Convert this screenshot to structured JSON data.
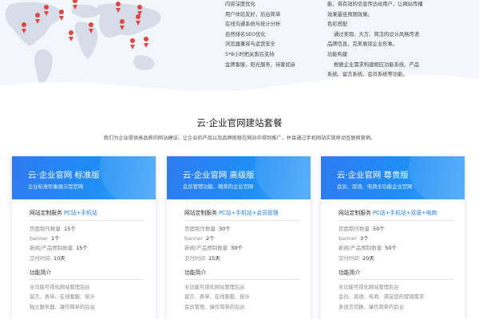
{
  "features_mid": [
    {
      "text": "内容深度优化",
      "indent": false
    },
    {
      "text": "用户体验友好，后台简单",
      "indent": false
    },
    {
      "text": "在线沟通系统与统计分析",
      "indent": false
    },
    {
      "text": "自然排名SEO优化",
      "indent": false
    },
    {
      "text": "浏览器兼容与运营安全",
      "indent": false
    },
    {
      "text": "5*8小时把关售后支持",
      "indent": false
    },
    {
      "text": "金牌客服，阳光服务，待客如亲",
      "indent": false
    }
  ],
  "features_right": [
    {
      "text": "能，将有效的信息传达给用户，让网站传播",
      "indent": false
    },
    {
      "text": "效果最佳预期效果。",
      "indent": false
    },
    {
      "text": "色彩搭配",
      "indent": false
    },
    {
      "text": "通过美观、大方、简洁的设计风格传递",
      "indent": true
    },
    {
      "text": "品牌信息，完美展现企业形象。",
      "indent": false
    },
    {
      "text": "功能构建",
      "indent": false
    },
    {
      "text": "根据企业需求构建相应功能系统、产品",
      "indent": true
    },
    {
      "text": "系统、留言系统、会员系统等功能。",
      "indent": false
    }
  ],
  "section": {
    "title": "云·企业官网建站套餐",
    "description": "我们为企业提供高品质的网站建设，让企业的产品以及品牌能够在网站中得到推广，并且通过手机网站实现移动互联网营销。"
  },
  "cards": [
    {
      "title": "云·企业官网 标准版",
      "subtitle": "企业标准形象展示型官网",
      "service_label": "网站定制服务",
      "service_value": "PC站+手机站",
      "specs": [
        {
          "label": "页面制作数量",
          "value": "15个"
        },
        {
          "label": "banner",
          "value": "1个"
        },
        {
          "label": "新闻/产品预制数量",
          "value": "15个"
        },
        {
          "label": "交付时间",
          "value": "10天"
        }
      ],
      "intro_title": "功能简介",
      "intro_lines": [
        "全功能可视化网站管理后台",
        "留言、表单、在线客服、统计",
        "独立服务器、操作简单的后台"
      ]
    },
    {
      "title": "云·企业官网 高级版",
      "subtitle": "会员管理功能、精美的企业官网",
      "service_label": "网站定制服务",
      "service_value": "PC站+手机站+会员管理",
      "specs": [
        {
          "label": "页面制作数量",
          "value": "30个"
        },
        {
          "label": "banner",
          "value": "2个"
        },
        {
          "label": "新闻/产品预制数量",
          "value": "30个"
        },
        {
          "label": "交付时间",
          "value": "15天"
        }
      ],
      "intro_title": "功能简介",
      "intro_lines": [
        "全功能可视化网站管理后台",
        "留言、表单、在线客服、统计",
        "会员管理、操作简单的后台"
      ]
    },
    {
      "title": "云·企业官网 尊贵版",
      "subtitle": "会员、双语、电商全功能企业官网",
      "service_label": "网站定制服务",
      "service_value": "PC站+手机站+双语+电商",
      "specs": [
        {
          "label": "页面制作数量",
          "value": "50个"
        },
        {
          "label": "banner",
          "value": "3个"
        },
        {
          "label": "新闻/产品预制数量",
          "value": "50个"
        },
        {
          "label": "交付时间",
          "value": "20天"
        }
      ],
      "intro_title": "功能简介",
      "intro_lines": [
        "全功能可视化网站管理后台",
        "会员、双语、电商、满足您的营销需求",
        "多语言切换、操作简单的后台"
      ]
    }
  ],
  "colors": {
    "accent": "#1f7ef1",
    "card_gradient_start": "#2f7bf0",
    "card_gradient_end": "#49a6fa",
    "map_pin": "#e2463f",
    "map_land": "#d6dde8"
  },
  "icons": {
    "map_pin": "map-pin-icon",
    "world_map": "world-map-illustration"
  }
}
